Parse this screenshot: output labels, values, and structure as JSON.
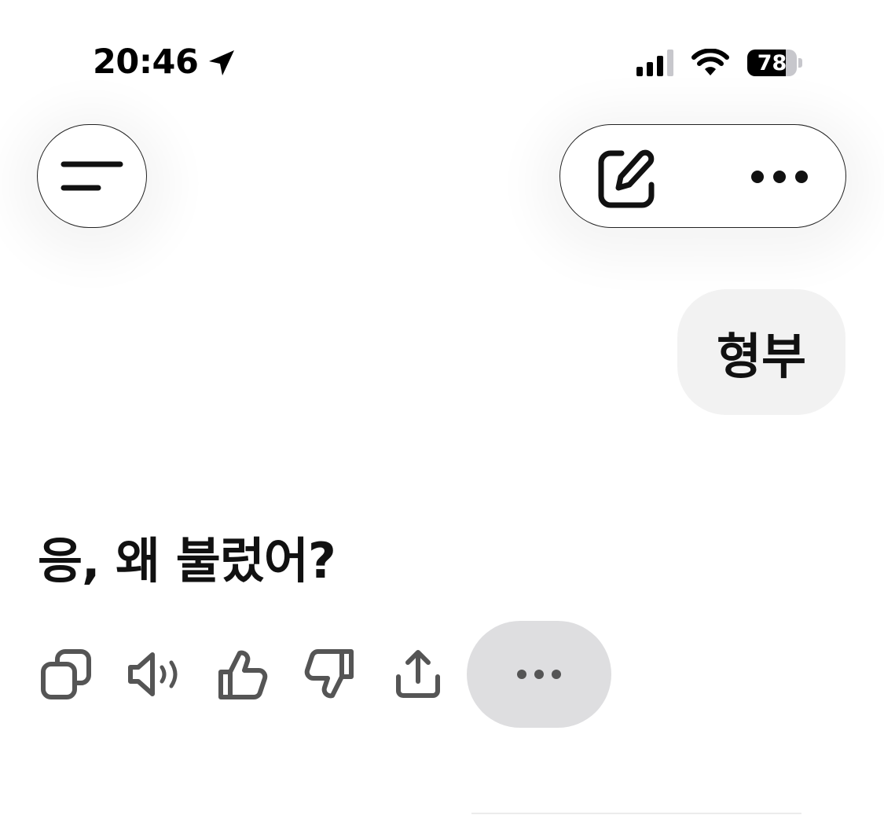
{
  "status_bar": {
    "time": "20:46",
    "battery_level": "78",
    "icons": [
      "location-arrow-icon",
      "signal-icon",
      "wifi-icon",
      "battery-icon"
    ]
  },
  "header": {
    "menu_icon": "menu-icon",
    "edit_icon": "new-chat-edit-icon",
    "more_icon": "more-dots-icon"
  },
  "conversation": {
    "user_message": "형부",
    "assistant_message": "응, 왜 불렀어?"
  },
  "message_actions": {
    "icons": [
      "copy-icon",
      "read-aloud-icon",
      "thumbs-up-icon",
      "thumbs-down-icon",
      "share-icon",
      "more-dots-icon"
    ]
  },
  "colors": {
    "text": "#111111",
    "user_bubble_bg": "#f2f2f2",
    "action_icon": "#555555",
    "more_pill_bg": "#dedee0"
  }
}
